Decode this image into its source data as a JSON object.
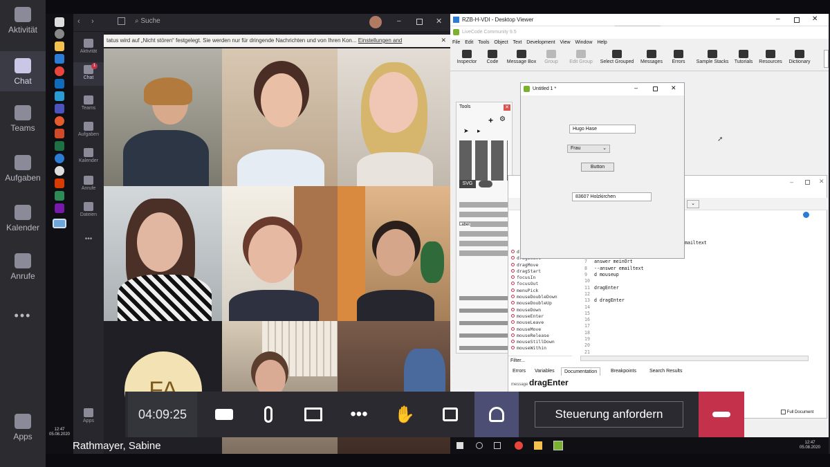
{
  "outer_rail": {
    "items": [
      {
        "label": "Aktivität",
        "icon": "bell-icon"
      },
      {
        "label": "Chat",
        "icon": "chat-icon"
      },
      {
        "label": "Teams",
        "icon": "teams-icon"
      },
      {
        "label": "Aufgaben",
        "icon": "tasks-icon"
      },
      {
        "label": "Kalender",
        "icon": "calendar-icon"
      },
      {
        "label": "Anrufe",
        "icon": "phone-icon"
      },
      {
        "label": "•••",
        "icon": "more-icon"
      },
      {
        "label": "Apps",
        "icon": "apps-icon"
      }
    ]
  },
  "inner_rail": {
    "items": [
      "Aktivität",
      "Chat",
      "Teams",
      "Aufgaben",
      "Kalender",
      "Anrufe",
      "Dateien",
      "•••",
      "Apps"
    ],
    "chat_badge": "1"
  },
  "inner_teams": {
    "search_placeholder": "Suche",
    "notice": "tatus wird auf „Nicht stören“ festgelegt. Sie werden nur für dringende Nachrichten und von Ihren Kon...",
    "notice_link": "Einstellungen and"
  },
  "participant": {
    "initials": "FA",
    "name": "Rathmayer, Sabine"
  },
  "call_bar": {
    "timer": "04:09:25",
    "request_control": "Steuerung anfordern"
  },
  "livecode": {
    "outer_title": "RZB-H-VDI - Desktop Viewer",
    "title": "LiveCode Community 9.5",
    "menus": [
      "File",
      "Edit",
      "Tools",
      "Object",
      "Text",
      "Development",
      "View",
      "Window",
      "Help"
    ],
    "toolbar": [
      "Inspector",
      "Code",
      "Message Box",
      "Group",
      "Edit Group",
      "Select Grouped",
      "Messages",
      "Errors",
      "Sample Stacks",
      "Tutorials",
      "Resources",
      "Dictionary"
    ],
    "tools_title": "Tools",
    "svg_label": "SVG",
    "label_text": "Label:",
    "stack": {
      "title": "Untitled 1 *",
      "field1": "Hugo Hase",
      "option": "Frau",
      "button": "Button",
      "field2": "83607 Holzkirchen"
    },
    "handlers": [
      "dragEnter",
      "dragLeave",
      "dragMove",
      "dragStart",
      "focusIn",
      "focusOut",
      "menuPick",
      "mouseDoubleDown",
      "mouseDoubleUp",
      "mouseDown",
      "mouseEnter",
      "mouseLeave",
      "mouseMove",
      "mouseRelease",
      "mouseStillDown",
      "mouseWithin"
    ],
    "filter_label": "Filter...",
    "code_partial": [
      {
        "n": "",
        "t": "ase"
      },
      {
        "n": "",
        "t": "ede into Anrede"
      },
      {
        "n": "",
        "t": "& Anrede &return&  meinName into emailtext"
      },
      {
        "n": "",
        "t": "rt\" into postleitzahl"
      },
      {
        "n": "",
        "t": "nto meinOrt"
      },
      {
        "n": "7",
        "t": "answer meinOrt"
      },
      {
        "n": "8",
        "t": "--answer emailtext"
      },
      {
        "n": "9",
        "t": "d mouseup"
      },
      {
        "n": "10",
        "t": ""
      },
      {
        "n": "11",
        "t": "dragEnter"
      },
      {
        "n": "12",
        "t": ""
      },
      {
        "n": "13",
        "t": "d dragEnter"
      },
      {
        "n": "14",
        "t": ""
      },
      {
        "n": "15",
        "t": ""
      },
      {
        "n": "16",
        "t": ""
      },
      {
        "n": "17",
        "t": ""
      },
      {
        "n": "18",
        "t": ""
      },
      {
        "n": "19",
        "t": ""
      },
      {
        "n": "20",
        "t": ""
      },
      {
        "n": "21",
        "t": ""
      }
    ],
    "tabs": [
      "Errors",
      "Variables",
      "Documentation",
      "Breakpoints",
      "Search Results"
    ],
    "doc_kind": "message",
    "doc_name": "dragEnter",
    "full_doc": "Full Document"
  },
  "taskbar_left": {
    "time": "12:47",
    "date": "05.08.2020"
  },
  "taskbar_right": {
    "time": "12:47",
    "date": "05.08.2020"
  },
  "colors": {
    "accent": "#6264a7",
    "hangup": "#c4314b",
    "teams_dark": "#2b2b30"
  }
}
